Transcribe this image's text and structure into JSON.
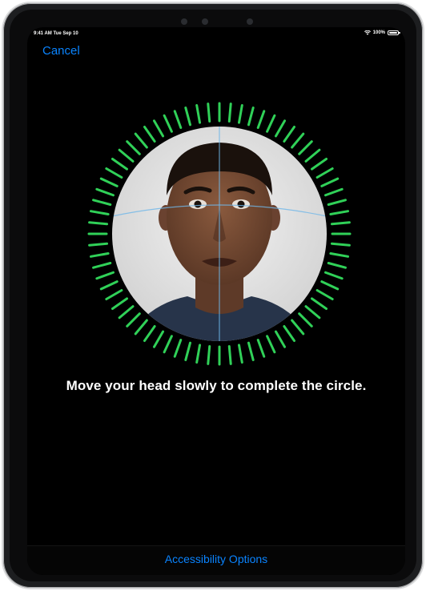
{
  "status_bar": {
    "time_date": "9:41 AM  Tue Sep 10",
    "battery": "100%",
    "wifi_icon": "wifi-icon",
    "battery_icon": "battery-icon"
  },
  "nav": {
    "cancel_label": "Cancel"
  },
  "face_scan": {
    "instruction": "Move your head slowly to complete the circle.",
    "progress": 1.0,
    "ring_color": "#30d158",
    "crosshair_color": "#6fb7e8"
  },
  "footer": {
    "accessibility_label": "Accessibility Options"
  },
  "colors": {
    "accent": "#0a84ff",
    "background": "#000000"
  }
}
